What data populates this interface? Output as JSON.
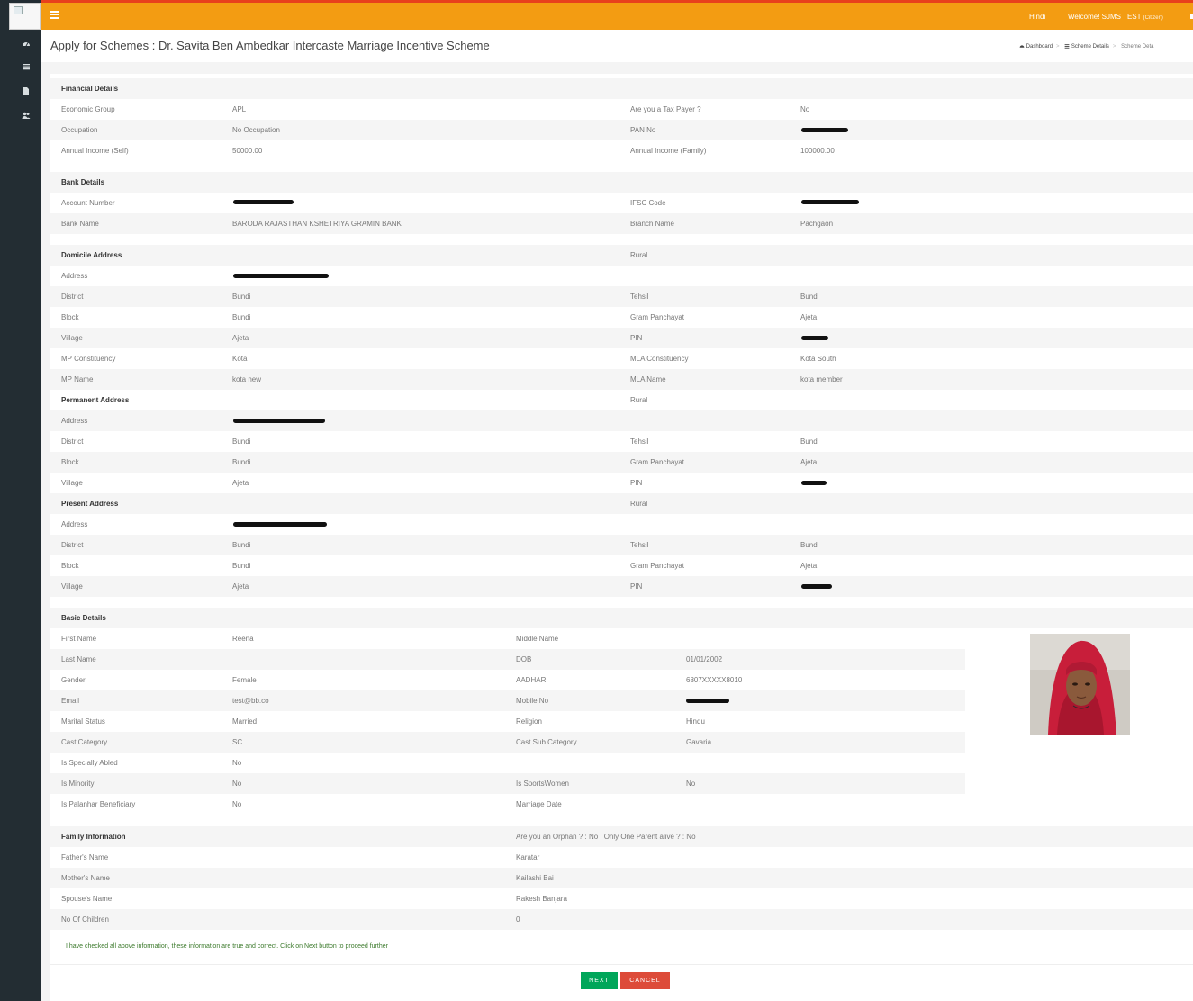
{
  "topbar": {
    "language": "Hindi",
    "welcome": "Welcome! SJMS TEST",
    "role": "(Citizen)"
  },
  "page": {
    "title": "Apply for Schemes : Dr. Savita Ben Ambedkar Intercaste Marriage Incentive Scheme"
  },
  "breadcrumb": {
    "dashboard": "Dashboard",
    "scheme_details": "Scheme Details",
    "current": "Scheme Deta"
  },
  "financial": {
    "heading": "Financial Details",
    "economic_group_label": "Economic Group",
    "economic_group": "APL",
    "tax_payer_label": "Are you a Tax Payer ?",
    "tax_payer": "No",
    "occupation_label": "Occupation",
    "occupation": "No Occupation",
    "pan_label": "PAN No",
    "income_self_label": "Annual Income (Self)",
    "income_self": "50000.00",
    "income_family_label": "Annual Income (Family)",
    "income_family": "100000.00"
  },
  "bank": {
    "heading": "Bank Details",
    "account_label": "Account Number",
    "ifsc_label": "IFSC Code",
    "bank_name_label": "Bank Name",
    "bank_name": "BARODA RAJASTHAN KSHETRIYA GRAMIN BANK",
    "branch_label": "Branch Name",
    "branch": "Pachgaon"
  },
  "domicile": {
    "heading": "Domicile Address",
    "area": "Rural",
    "address_label": "Address",
    "district_label": "District",
    "district": "Bundi",
    "tehsil_label": "Tehsil",
    "tehsil": "Bundi",
    "block_label": "Block",
    "block": "Bundi",
    "gp_label": "Gram Panchayat",
    "gp": "Ajeta",
    "village_label": "Village",
    "village": "Ajeta",
    "pin_label": "PIN",
    "mp_const_label": "MP Constituency",
    "mp_const": "Kota",
    "mla_const_label": "MLA Constituency",
    "mla_const": "Kota South",
    "mp_name_label": "MP Name",
    "mp_name": "kota new",
    "mla_name_label": "MLA Name",
    "mla_name": "kota member"
  },
  "permanent": {
    "heading": "Permanent Address",
    "area": "Rural",
    "address_label": "Address",
    "district_label": "District",
    "district": "Bundi",
    "tehsil_label": "Tehsil",
    "tehsil": "Bundi",
    "block_label": "Block",
    "block": "Bundi",
    "gp_label": "Gram Panchayat",
    "gp": "Ajeta",
    "village_label": "Village",
    "village": "Ajeta",
    "pin_label": "PIN"
  },
  "present": {
    "heading": "Present Address",
    "area": "Rural",
    "address_label": "Address",
    "district_label": "District",
    "district": "Bundi",
    "tehsil_label": "Tehsil",
    "tehsil": "Bundi",
    "block_label": "Block",
    "block": "Bundi",
    "gp_label": "Gram Panchayat",
    "gp": "Ajeta",
    "village_label": "Village",
    "village": "Ajeta",
    "pin_label": "PIN"
  },
  "basic": {
    "heading": "Basic Details",
    "first_name_label": "First Name",
    "first_name": "Reena",
    "middle_name_label": "Middle Name",
    "last_name_label": "Last Name",
    "dob_label": "DOB",
    "dob": "01/01/2002",
    "gender_label": "Gender",
    "gender": "Female",
    "aadhar_label": "AADHAR",
    "aadhar": "6807XXXXX8010",
    "email_label": "Email",
    "email": "test@bb.co",
    "mobile_label": "Mobile No",
    "marital_label": "Marital Status",
    "marital": "Married",
    "religion_label": "Religion",
    "religion": "Hindu",
    "cast_label": "Cast Category",
    "cast": "SC",
    "cast_sub_label": "Cast Sub Category",
    "cast_sub": "Gavaria",
    "specially_label": "Is Specially Abled",
    "specially": "No",
    "minority_label": "Is Minority",
    "minority": "No",
    "sports_label": "Is SportsWomen",
    "sports": "No",
    "palanhar_label": "Is Palanhar Beneficiary",
    "palanhar": "No",
    "marriage_label": "Marriage Date"
  },
  "family": {
    "heading": "Family Information",
    "orphan_text": "Are you an Orphan ? : No | Only One Parent alive ? : No",
    "father_label": "Father's Name",
    "father": "Karatar",
    "mother_label": "Mother's Name",
    "mother": "Kailashi Bai",
    "spouse_label": "Spouse's Name",
    "spouse": "Rakesh Banjara",
    "children_label": "No Of Children",
    "children": "0"
  },
  "declaration": "I have checked all above information, these information are true and correct. Click on Next button to proceed further",
  "buttons": {
    "next": "NEXT",
    "cancel": "CANCEL"
  },
  "colors": {
    "topbar": "#f39c12",
    "sidebar": "#232d33",
    "next": "#00a65a",
    "cancel": "#dd4b39"
  },
  "icons": [
    "dashboard-icon",
    "list-icon",
    "file-icon",
    "users-icon",
    "hamburger-icon"
  ]
}
